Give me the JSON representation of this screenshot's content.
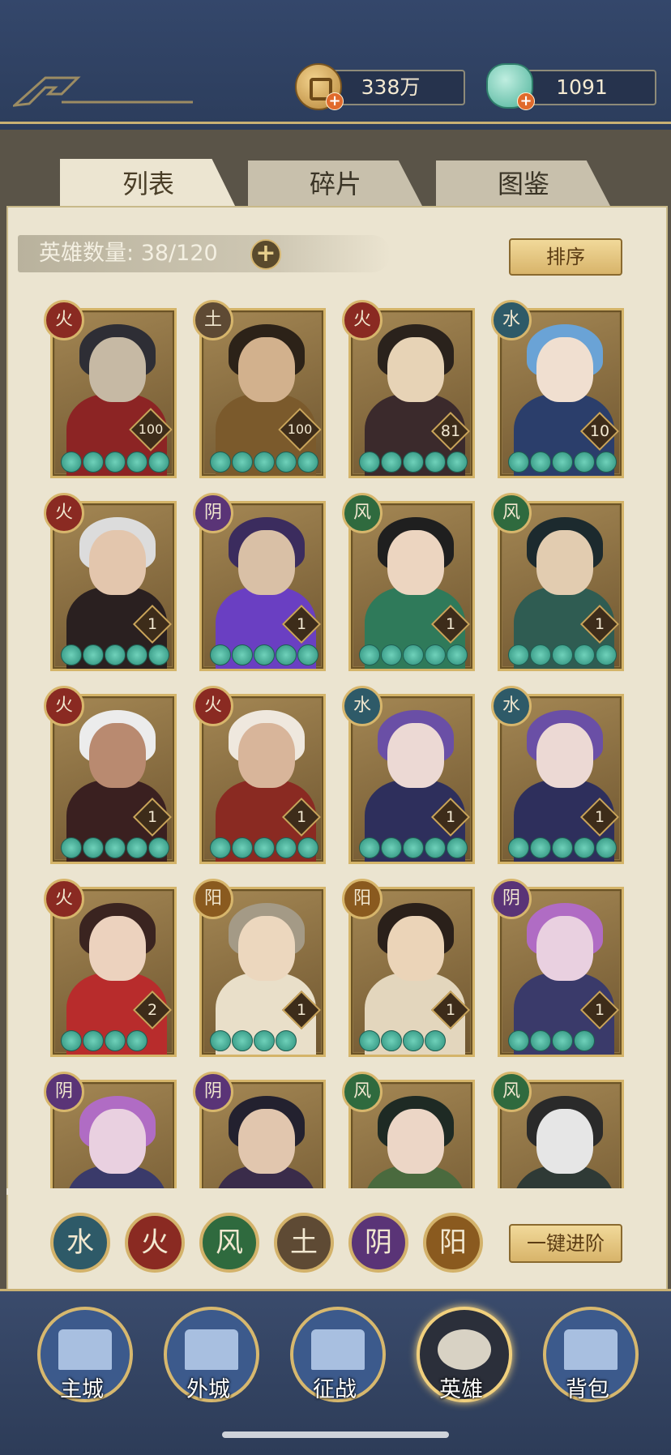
{
  "currencies": [
    {
      "icon": "copper-coin-icon",
      "value": "338万"
    },
    {
      "icon": "jade-pouch-icon",
      "value": "1091"
    }
  ],
  "tabs": [
    {
      "label": "列表",
      "active": true
    },
    {
      "label": "碎片",
      "active": false
    },
    {
      "label": "图鉴",
      "active": false
    }
  ],
  "hero_count": {
    "label": "英雄数量:",
    "value": "38/120"
  },
  "sort_label": "排序",
  "auto_advance_label": "一键进阶",
  "element_colors": {
    "火": "#8a2a22",
    "土": "#5e4a34",
    "水": "#2e5a68",
    "阴": "#5a3477",
    "风": "#2f6a3e",
    "阳": "#8a5a1f"
  },
  "heroes": [
    {
      "element": "火",
      "level": "100",
      "stars": 5,
      "palette": [
        "#2e2e35",
        "#c6b9a4",
        "#8c2424"
      ]
    },
    {
      "element": "土",
      "level": "100",
      "stars": 5,
      "palette": [
        "#2c2218",
        "#d2b18d",
        "#7b5a2c"
      ]
    },
    {
      "element": "火",
      "level": "81",
      "stars": 5,
      "palette": [
        "#2a221c",
        "#e7d3b6",
        "#3b2a2c"
      ]
    },
    {
      "element": "水",
      "level": "10",
      "stars": 5,
      "palette": [
        "#6aa3d6",
        "#f0dfd0",
        "#2b3e6b"
      ]
    },
    {
      "element": "火",
      "level": "1",
      "stars": 5,
      "palette": [
        "#dcdcdc",
        "#e3c6ad",
        "#2a2020"
      ]
    },
    {
      "element": "阴",
      "level": "1",
      "stars": 5,
      "palette": [
        "#3b2c5e",
        "#d9c0a6",
        "#6a3fc2"
      ]
    },
    {
      "element": "风",
      "level": "1",
      "stars": 5,
      "palette": [
        "#1f1f1f",
        "#ecd5c0",
        "#2f7a5a"
      ]
    },
    {
      "element": "风",
      "level": "1",
      "stars": 5,
      "palette": [
        "#1c2a2e",
        "#e2ccb0",
        "#2f5c52"
      ]
    },
    {
      "element": "火",
      "level": "1",
      "stars": 5,
      "palette": [
        "#ececec",
        "#b98a70",
        "#3a2020"
      ]
    },
    {
      "element": "火",
      "level": "1",
      "stars": 5,
      "palette": [
        "#efe8de",
        "#d8b59a",
        "#8a2a22"
      ]
    },
    {
      "element": "水",
      "level": "1",
      "stars": 5,
      "palette": [
        "#6a4fa6",
        "#ecd9d4",
        "#2e2f5c"
      ]
    },
    {
      "element": "水",
      "level": "1",
      "stars": 5,
      "palette": [
        "#6a4fa6",
        "#ecd9d4",
        "#2e2f5c"
      ]
    },
    {
      "element": "火",
      "level": "2",
      "stars": 4,
      "palette": [
        "#3a2420",
        "#ecd2be",
        "#b82c2c"
      ]
    },
    {
      "element": "阳",
      "level": "1",
      "stars": 4,
      "palette": [
        "#a49a86",
        "#ecd7be",
        "#e9dfc9"
      ]
    },
    {
      "element": "阳",
      "level": "1",
      "stars": 4,
      "palette": [
        "#2a201a",
        "#ebd4b8",
        "#e3d6bd"
      ]
    },
    {
      "element": "阴",
      "level": "1",
      "stars": 4,
      "palette": [
        "#b06cc4",
        "#e9d0e0",
        "#3a3a6a"
      ]
    },
    {
      "element": "阴",
      "level": "",
      "stars": 0,
      "palette": [
        "#b06cc4",
        "#e9d0e0",
        "#3a3a6a"
      ]
    },
    {
      "element": "阴",
      "level": "",
      "stars": 0,
      "palette": [
        "#23212f",
        "#e1c6ae",
        "#3a2c4a"
      ]
    },
    {
      "element": "风",
      "level": "",
      "stars": 0,
      "palette": [
        "#1e2a24",
        "#ecd6c6",
        "#4a6a3e"
      ]
    },
    {
      "element": "风",
      "level": "",
      "stars": 0,
      "palette": [
        "#2a2a2a",
        "#e6e6e6",
        "#2f3a36"
      ]
    }
  ],
  "element_filters": [
    "水",
    "火",
    "风",
    "土",
    "阴",
    "阳"
  ],
  "nav": [
    {
      "label": "主城",
      "icon": "main-city-icon",
      "active": false
    },
    {
      "label": "外城",
      "icon": "outer-city-icon",
      "active": false
    },
    {
      "label": "征战",
      "icon": "campaign-icon",
      "active": false
    },
    {
      "label": "英雄",
      "icon": "heroes-icon",
      "active": true
    },
    {
      "label": "背包",
      "icon": "backpack-icon",
      "active": false
    }
  ]
}
